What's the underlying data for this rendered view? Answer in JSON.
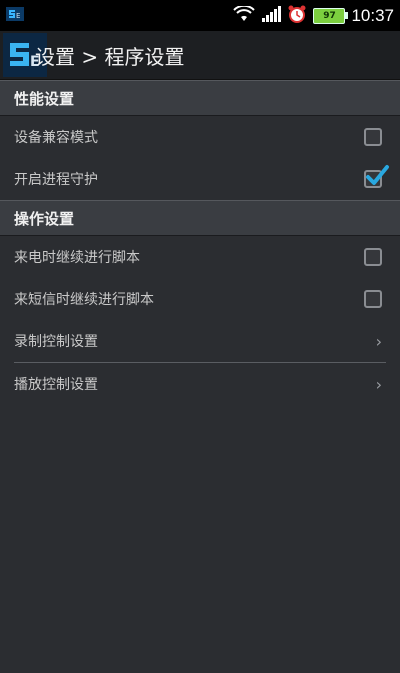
{
  "status": {
    "time": "10:37",
    "battery": "97"
  },
  "titlebar": {
    "title": "设置 > 程序设置"
  },
  "sections": [
    {
      "header": "性能设置",
      "items": [
        {
          "label": "设备兼容模式",
          "type": "checkbox",
          "checked": false
        },
        {
          "label": "开启进程守护",
          "type": "checkbox",
          "checked": true
        }
      ]
    },
    {
      "header": "操作设置",
      "items": [
        {
          "label": "来电时继续进行脚本",
          "type": "checkbox",
          "checked": false
        },
        {
          "label": "来短信时继续进行脚本",
          "type": "checkbox",
          "checked": false
        },
        {
          "label": "录制控制设置",
          "type": "chevron"
        },
        {
          "label": "播放控制设置",
          "type": "chevron"
        }
      ]
    }
  ],
  "colors": {
    "accent_check": "#29a8e0",
    "background": "#2b2d31",
    "section_bg": "#3a3d42"
  },
  "icons": {
    "chevron": "›"
  }
}
